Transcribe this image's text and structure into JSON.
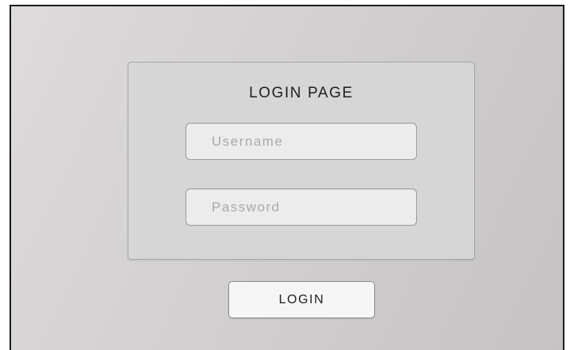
{
  "login_panel": {
    "title": "LOGIN PAGE",
    "username": {
      "value": "",
      "placeholder": "Username"
    },
    "password": {
      "value": "",
      "placeholder": "Password"
    }
  },
  "login_button": {
    "label": "LOGIN"
  },
  "colors": {
    "background": "#d3d0d1",
    "panel": "#d6d6d6",
    "field": "#ececec",
    "button": "#f6f6f6",
    "text": "#1e1e1e",
    "placeholder": "#a9a9a9"
  }
}
